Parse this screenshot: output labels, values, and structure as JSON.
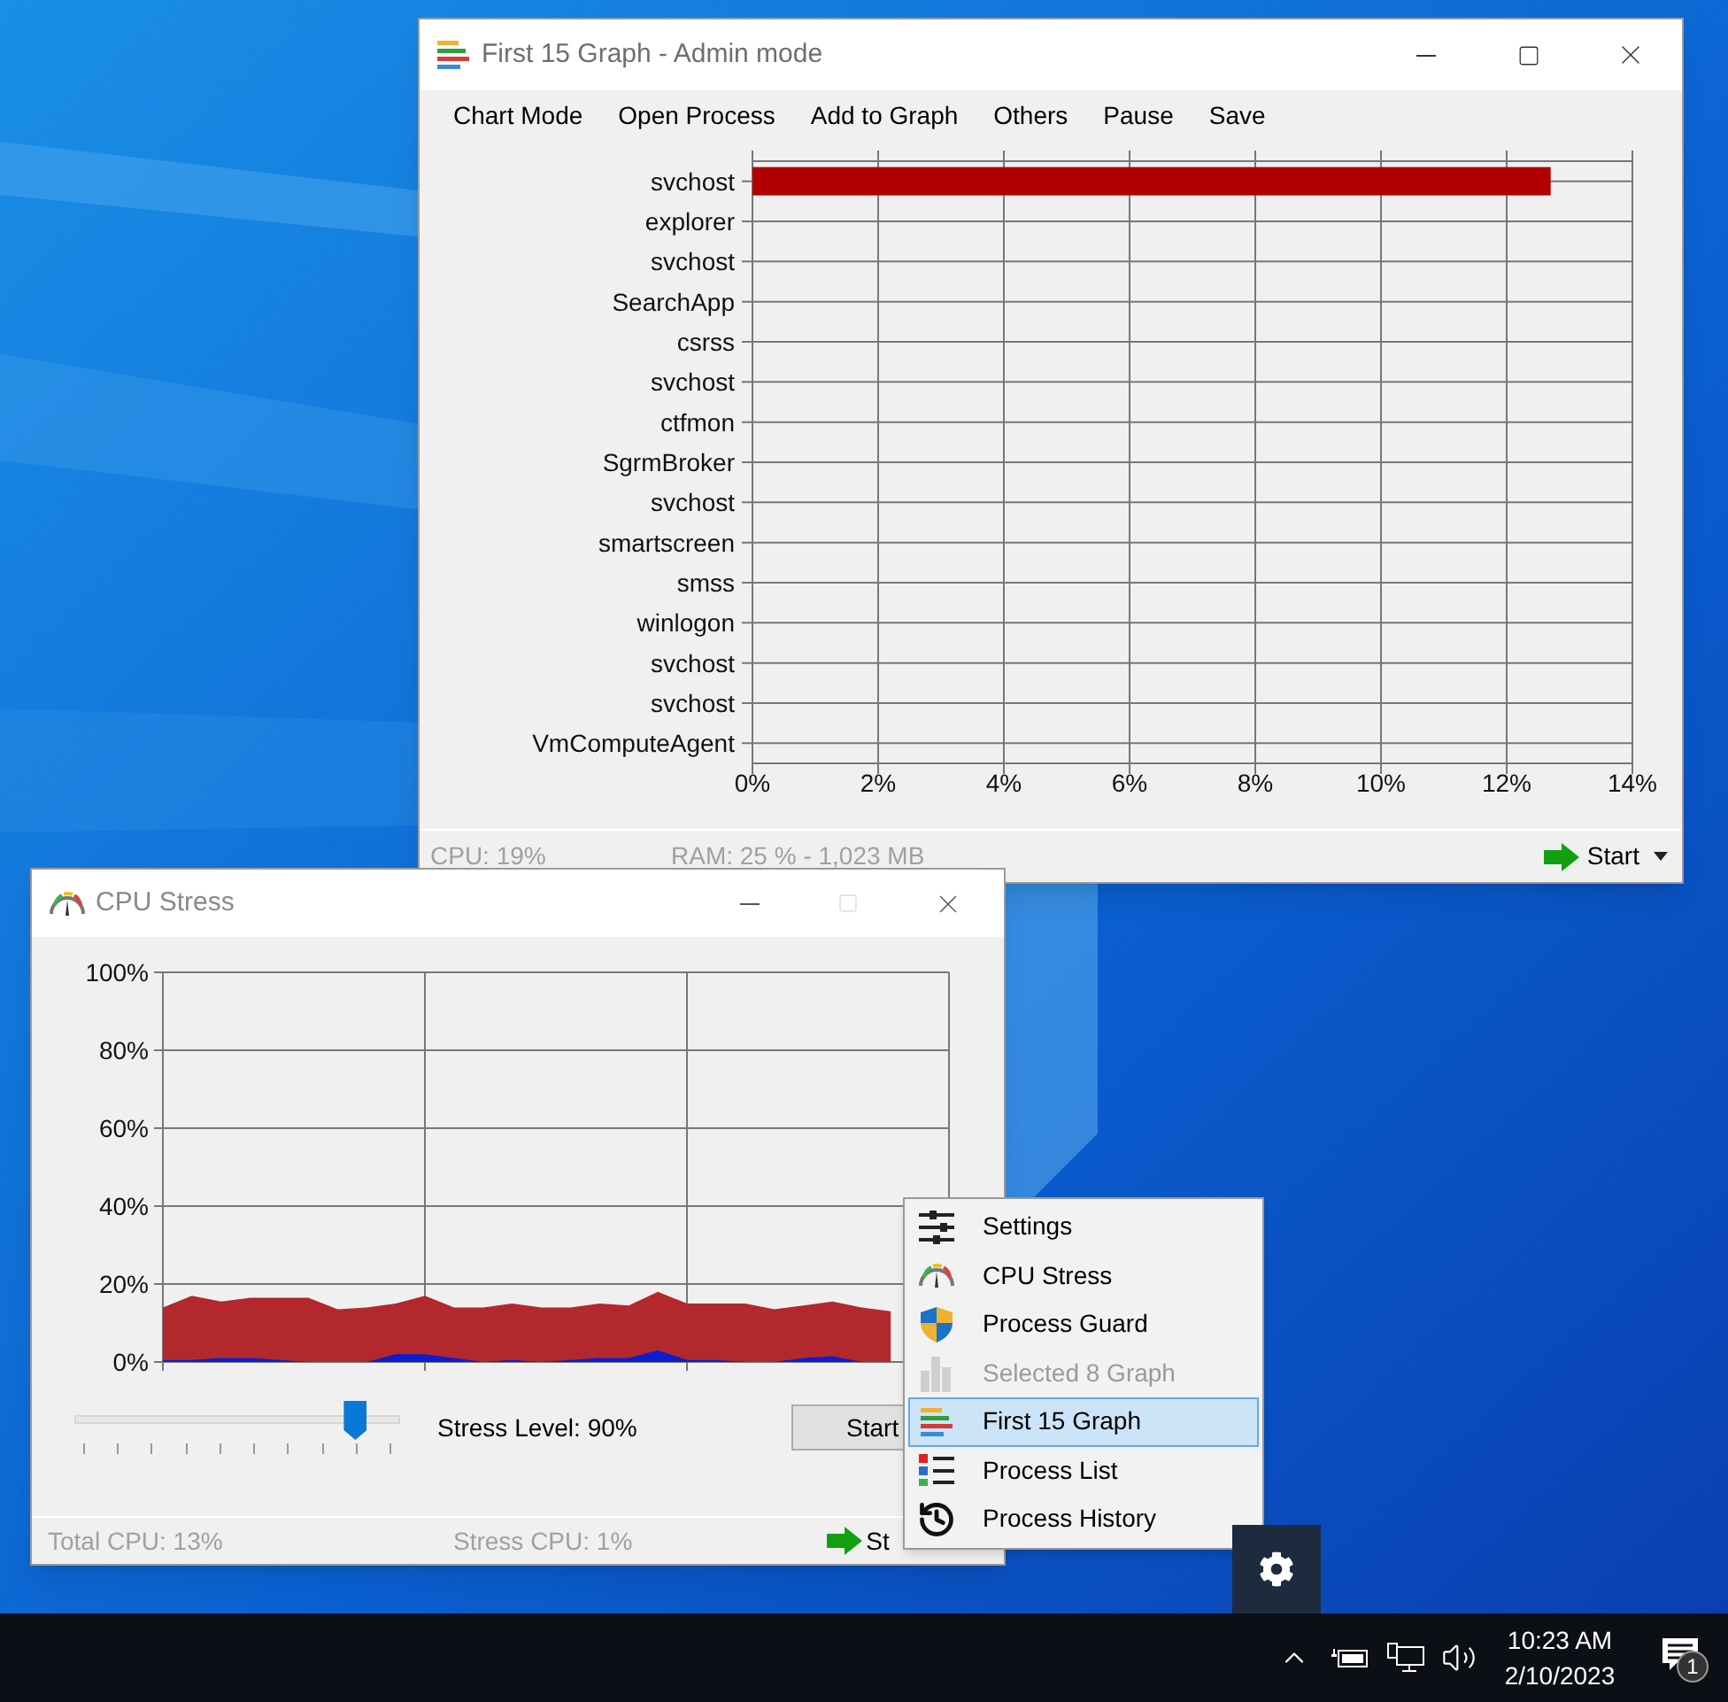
{
  "graph_window": {
    "title": "First 15 Graph - Admin mode",
    "menu": [
      "Chart Mode",
      "Open Process",
      "Add to Graph",
      "Others",
      "Pause",
      "Save"
    ],
    "chart_data": {
      "type": "bar",
      "orientation": "horizontal",
      "categories": [
        "svchost",
        "explorer",
        "svchost",
        "SearchApp",
        "csrss",
        "svchost",
        "ctfmon",
        "SgrmBroker",
        "svchost",
        "smartscreen",
        "smss",
        "winlogon",
        "svchost",
        "svchost",
        "VmComputeAgent"
      ],
      "grid": true,
      "series": [
        {
          "color": "#b00000",
          "values": [
            12.7,
            0,
            0,
            0,
            0,
            0,
            0,
            0,
            0,
            0,
            0,
            0,
            0,
            0,
            0
          ]
        }
      ],
      "xlim": [
        0,
        14
      ],
      "xticks": [
        {
          "value": 0,
          "label": "0%"
        },
        {
          "value": 2,
          "label": "2%"
        },
        {
          "value": 4,
          "label": "4%"
        },
        {
          "value": 6,
          "label": "6%"
        },
        {
          "value": 8,
          "label": "8%"
        },
        {
          "value": 10,
          "label": "10%"
        },
        {
          "value": 12,
          "label": "12%"
        },
        {
          "value": 14,
          "label": "14%"
        }
      ]
    },
    "status": {
      "cpu": "CPU: 19%",
      "ram": "RAM: 25 % - 1,023 MB"
    },
    "start_button": "Start"
  },
  "stress_window": {
    "title": "CPU Stress",
    "chart_data": {
      "type": "area",
      "ylim": [
        0,
        100
      ],
      "grid": true,
      "yticks": [
        {
          "value": 0,
          "label": "0%"
        },
        {
          "value": 20,
          "label": "20%"
        },
        {
          "value": 40,
          "label": "40%"
        },
        {
          "value": 60,
          "label": "60%"
        },
        {
          "value": 80,
          "label": "80%"
        },
        {
          "value": 100,
          "label": "100%"
        }
      ],
      "series": [
        {
          "color": "#b3282d",
          "values": [
            14,
            17,
            15.5,
            16.5,
            16.5,
            16.5,
            13.5,
            14,
            15,
            17,
            14,
            14,
            15,
            14,
            14,
            15,
            14.5,
            18,
            15,
            15,
            15,
            13.5,
            14.5,
            15.5,
            14,
            13,
            null,
            null
          ]
        },
        {
          "color": "#0a1ed0",
          "values": [
            0.5,
            0.5,
            1,
            1,
            0.5,
            0,
            0,
            0,
            2,
            2,
            1,
            0,
            0.5,
            0,
            0.5,
            1,
            1,
            3,
            0.5,
            0.5,
            0,
            0,
            1,
            1.5,
            0,
            0,
            null,
            null
          ]
        }
      ]
    },
    "stress_slider": {
      "level": 0.89
    },
    "stress_label": "Stress Level: 90%",
    "start_button": "Start",
    "status": {
      "total_cpu": "Total CPU: 13%",
      "stress_cpu": "Stress CPU: 1%",
      "start": "St"
    }
  },
  "context_menu": {
    "items": [
      {
        "label": "Settings",
        "disabled": false,
        "selected": false
      },
      {
        "label": "CPU Stress",
        "disabled": false,
        "selected": false
      },
      {
        "label": "Process Guard",
        "disabled": false,
        "selected": false
      },
      {
        "label": "Selected 8 Graph",
        "disabled": true,
        "selected": false
      },
      {
        "label": "First 15 Graph",
        "disabled": false,
        "selected": true
      },
      {
        "label": "Process List",
        "disabled": false,
        "selected": false
      },
      {
        "label": "Process History",
        "disabled": false,
        "selected": false
      }
    ]
  },
  "taskbar": {
    "time": "10:23 AM",
    "date": "2/10/2023",
    "notification_count": "1"
  }
}
